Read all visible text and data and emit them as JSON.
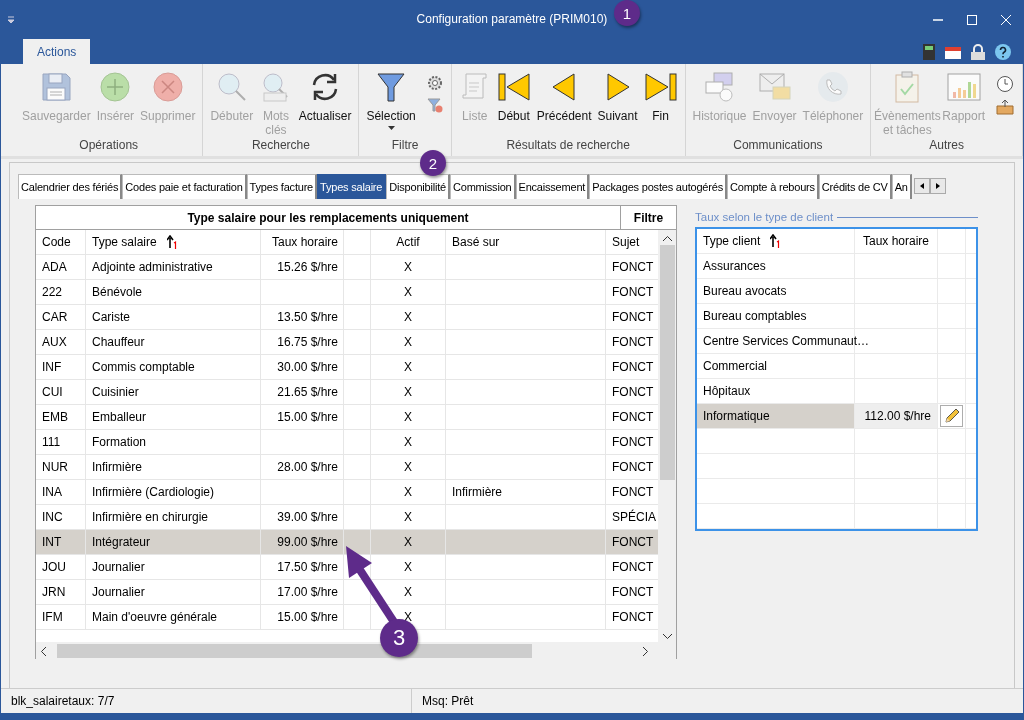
{
  "window": {
    "title": "Configuration paramètre (PRIM010)"
  },
  "ribbon_tabs": [
    {
      "label": "Actions",
      "selected": true
    }
  ],
  "ribbon": {
    "groups": [
      {
        "label": "Opérations",
        "buttons": [
          {
            "label": "Sauvegarder",
            "kind": "save",
            "disabled": true
          },
          {
            "label": "Insérer",
            "kind": "add",
            "disabled": true
          },
          {
            "label": "Supprimer",
            "kind": "delete",
            "disabled": true
          }
        ]
      },
      {
        "label": "Recherche",
        "buttons": [
          {
            "label": "Débuter",
            "kind": "search",
            "disabled": true
          },
          {
            "label": "Mots clés",
            "kind": "keywords",
            "disabled": true
          },
          {
            "label": "Actualiser",
            "kind": "refresh",
            "disabled": false
          }
        ]
      },
      {
        "label": "Filtre",
        "buttons": [
          {
            "label": "Sélection",
            "kind": "filter",
            "disabled": false,
            "dropdown": true
          }
        ],
        "small": [
          {
            "kind": "gear"
          },
          {
            "kind": "filter-clear"
          }
        ]
      },
      {
        "label": "Résultats de recherche",
        "buttons": [
          {
            "label": "Liste",
            "kind": "list",
            "disabled": true
          },
          {
            "label": "Début",
            "kind": "first",
            "disabled": false
          },
          {
            "label": "Précédent",
            "kind": "prev",
            "disabled": false
          },
          {
            "label": "Suivant",
            "kind": "next",
            "disabled": false
          },
          {
            "label": "Fin",
            "kind": "last",
            "disabled": false
          }
        ]
      },
      {
        "label": "Communications",
        "buttons": [
          {
            "label": "Historique",
            "kind": "history",
            "disabled": true
          },
          {
            "label": "Envoyer",
            "kind": "mail",
            "disabled": true
          },
          {
            "label": "Téléphoner",
            "kind": "phone",
            "disabled": true
          }
        ]
      },
      {
        "label": "Autres",
        "buttons": [
          {
            "label": "Évènements et tâches",
            "kind": "tasks",
            "disabled": true
          },
          {
            "label": "Rapport",
            "kind": "report",
            "disabled": true
          }
        ],
        "small": [
          {
            "kind": "clock"
          },
          {
            "kind": "tray"
          }
        ]
      }
    ]
  },
  "tabs": [
    {
      "label": "Calendrier des fériés",
      "selected": false
    },
    {
      "label": "Codes paie et facturation",
      "selected": false
    },
    {
      "label": "Types facture",
      "selected": false
    },
    {
      "label": "Types salaire",
      "selected": true
    },
    {
      "label": "Disponibilité",
      "selected": false
    },
    {
      "label": "Commission",
      "selected": false
    },
    {
      "label": "Encaissement",
      "selected": false
    },
    {
      "label": "Packages postes autogérés",
      "selected": false
    },
    {
      "label": "Compte à rebours",
      "selected": false
    },
    {
      "label": "Crédits de CV",
      "selected": false
    },
    {
      "label": "An",
      "selected": false
    }
  ],
  "salary_table": {
    "title": "Type salaire pour les remplacements uniquement",
    "filter_title": "Filtre",
    "columns": [
      "Code",
      "Type salaire",
      "Taux horaire",
      "Actif",
      "Basé sur",
      "Sujet"
    ],
    "rows": [
      {
        "code": "ADA",
        "type": "Adjointe administrative",
        "rate": "15.26 $/hre",
        "active": "X",
        "based_on": "",
        "subject": "FONCT",
        "selected": false
      },
      {
        "code": "222",
        "type": "Bénévole",
        "rate": "",
        "active": "X",
        "based_on": "",
        "subject": "FONCT",
        "selected": false
      },
      {
        "code": "CAR",
        "type": "Cariste",
        "rate": "13.50 $/hre",
        "active": "X",
        "based_on": "",
        "subject": "FONCT",
        "selected": false
      },
      {
        "code": "AUX",
        "type": "Chauffeur",
        "rate": "16.75 $/hre",
        "active": "X",
        "based_on": "",
        "subject": "FONCT",
        "selected": false
      },
      {
        "code": "INF",
        "type": "Commis comptable",
        "rate": "30.00 $/hre",
        "active": "X",
        "based_on": "",
        "subject": "FONCT",
        "selected": false
      },
      {
        "code": "CUI",
        "type": "Cuisinier",
        "rate": "21.65 $/hre",
        "active": "X",
        "based_on": "",
        "subject": "FONCT",
        "selected": false
      },
      {
        "code": "EMB",
        "type": "Emballeur",
        "rate": "15.00 $/hre",
        "active": "X",
        "based_on": "",
        "subject": "FONCT",
        "selected": false
      },
      {
        "code": "111",
        "type": "Formation",
        "rate": "",
        "active": "X",
        "based_on": "",
        "subject": "FONCT",
        "selected": false
      },
      {
        "code": "NUR",
        "type": "Infirmière",
        "rate": "28.00 $/hre",
        "active": "X",
        "based_on": "",
        "subject": "FONCT",
        "selected": false
      },
      {
        "code": "INA",
        "type": "Infirmière (Cardiologie)",
        "rate": "",
        "active": "X",
        "based_on": "Infirmière",
        "subject": "FONCT",
        "selected": false
      },
      {
        "code": "INC",
        "type": "Infirmière en chirurgie",
        "rate": "39.00 $/hre",
        "active": "X",
        "based_on": "",
        "subject": "SPÉCIA",
        "selected": false
      },
      {
        "code": "INT",
        "type": "Intégrateur",
        "rate": "99.00 $/hre",
        "active": "X",
        "based_on": "",
        "subject": "FONCT",
        "selected": true
      },
      {
        "code": "JOU",
        "type": "Journalier",
        "rate": "17.50 $/hre",
        "active": "X",
        "based_on": "",
        "subject": "FONCT",
        "selected": false
      },
      {
        "code": "JRN",
        "type": "Journalier",
        "rate": "17.00 $/hre",
        "active": "X",
        "based_on": "",
        "subject": "FONCT",
        "selected": false
      },
      {
        "code": "IFM",
        "type": "Main d'oeuvre générale",
        "rate": "15.00 $/hre",
        "active": "X",
        "based_on": "",
        "subject": "FONCT",
        "selected": false
      }
    ]
  },
  "client_rates": {
    "title": "Taux selon le type de client",
    "columns": [
      "Type client",
      "Taux horaire"
    ],
    "rows": [
      {
        "client_type": "Assurances",
        "rate": "",
        "selected": false
      },
      {
        "client_type": "Bureau avocats",
        "rate": "",
        "selected": false
      },
      {
        "client_type": "Bureau comptables",
        "rate": "",
        "selected": false
      },
      {
        "client_type": "Centre Services Communaut…",
        "rate": "",
        "selected": false
      },
      {
        "client_type": "Commercial",
        "rate": "",
        "selected": false
      },
      {
        "client_type": "Hôpitaux",
        "rate": "",
        "selected": false
      },
      {
        "client_type": "Informatique",
        "rate": "112.00 $/hre",
        "selected": true
      }
    ]
  },
  "status_bar": {
    "left": "blk_salairetaux: 7/7",
    "right": "Msq: Prêt"
  },
  "callouts": [
    {
      "label": "1"
    },
    {
      "label": "2"
    },
    {
      "label": "3"
    }
  ]
}
